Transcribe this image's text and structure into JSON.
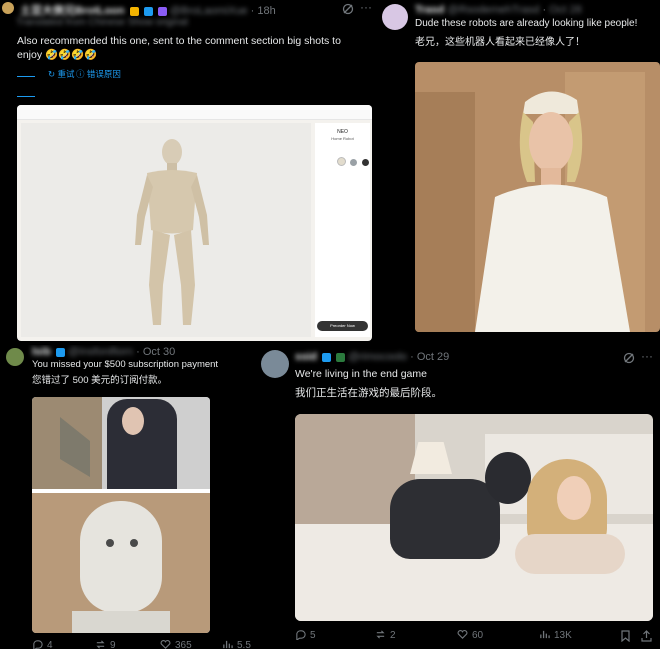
{
  "tweet1": {
    "display_name": "土豆大侠兄BrotLoon",
    "handle": "@BroLaomiXue",
    "time": "18h",
    "translated_note": "Translated from Chinese  Show original",
    "text": "Also recommended this one, sent to the comment section big shots to enjoy 🤣🤣🤣🤣",
    "actions": [
      "重试",
      "错误原因"
    ],
    "image": {
      "product_title": "NEO",
      "product_subtitle": "Home Robot",
      "cta_label": "Preorder Now"
    }
  },
  "tweet2": {
    "display_name": "Trasd",
    "handle": "@RsodemehTrasd",
    "time": "Oct 28",
    "text_en": "Dude these robots are already looking like people!",
    "text_zh": "老兄，这些机器人看起来已经像人了！"
  },
  "tweet3": {
    "display_name": "lsib",
    "handle": "@Insfonifiorn",
    "time": "Oct 30",
    "text_en": "You missed your $500 subscription payment",
    "text_zh": "您错过了 500 美元的订阅付款。",
    "stats": {
      "replies": "4",
      "reposts": "9",
      "likes": "365",
      "views": "5.5"
    }
  },
  "tweet4": {
    "display_name": "ssid",
    "handle": "@rimocoolo",
    "time": "Oct 29",
    "text_en": "We're living in the end game",
    "text_zh": "我们正生活在游戏的最后阶段。",
    "stats": {
      "replies": "5",
      "reposts": "2",
      "likes": "60",
      "views": "13K"
    }
  },
  "colors": {
    "background": "#000000",
    "text": "#e7e9ea",
    "muted": "#71767b",
    "link": "#1d9bf0"
  }
}
